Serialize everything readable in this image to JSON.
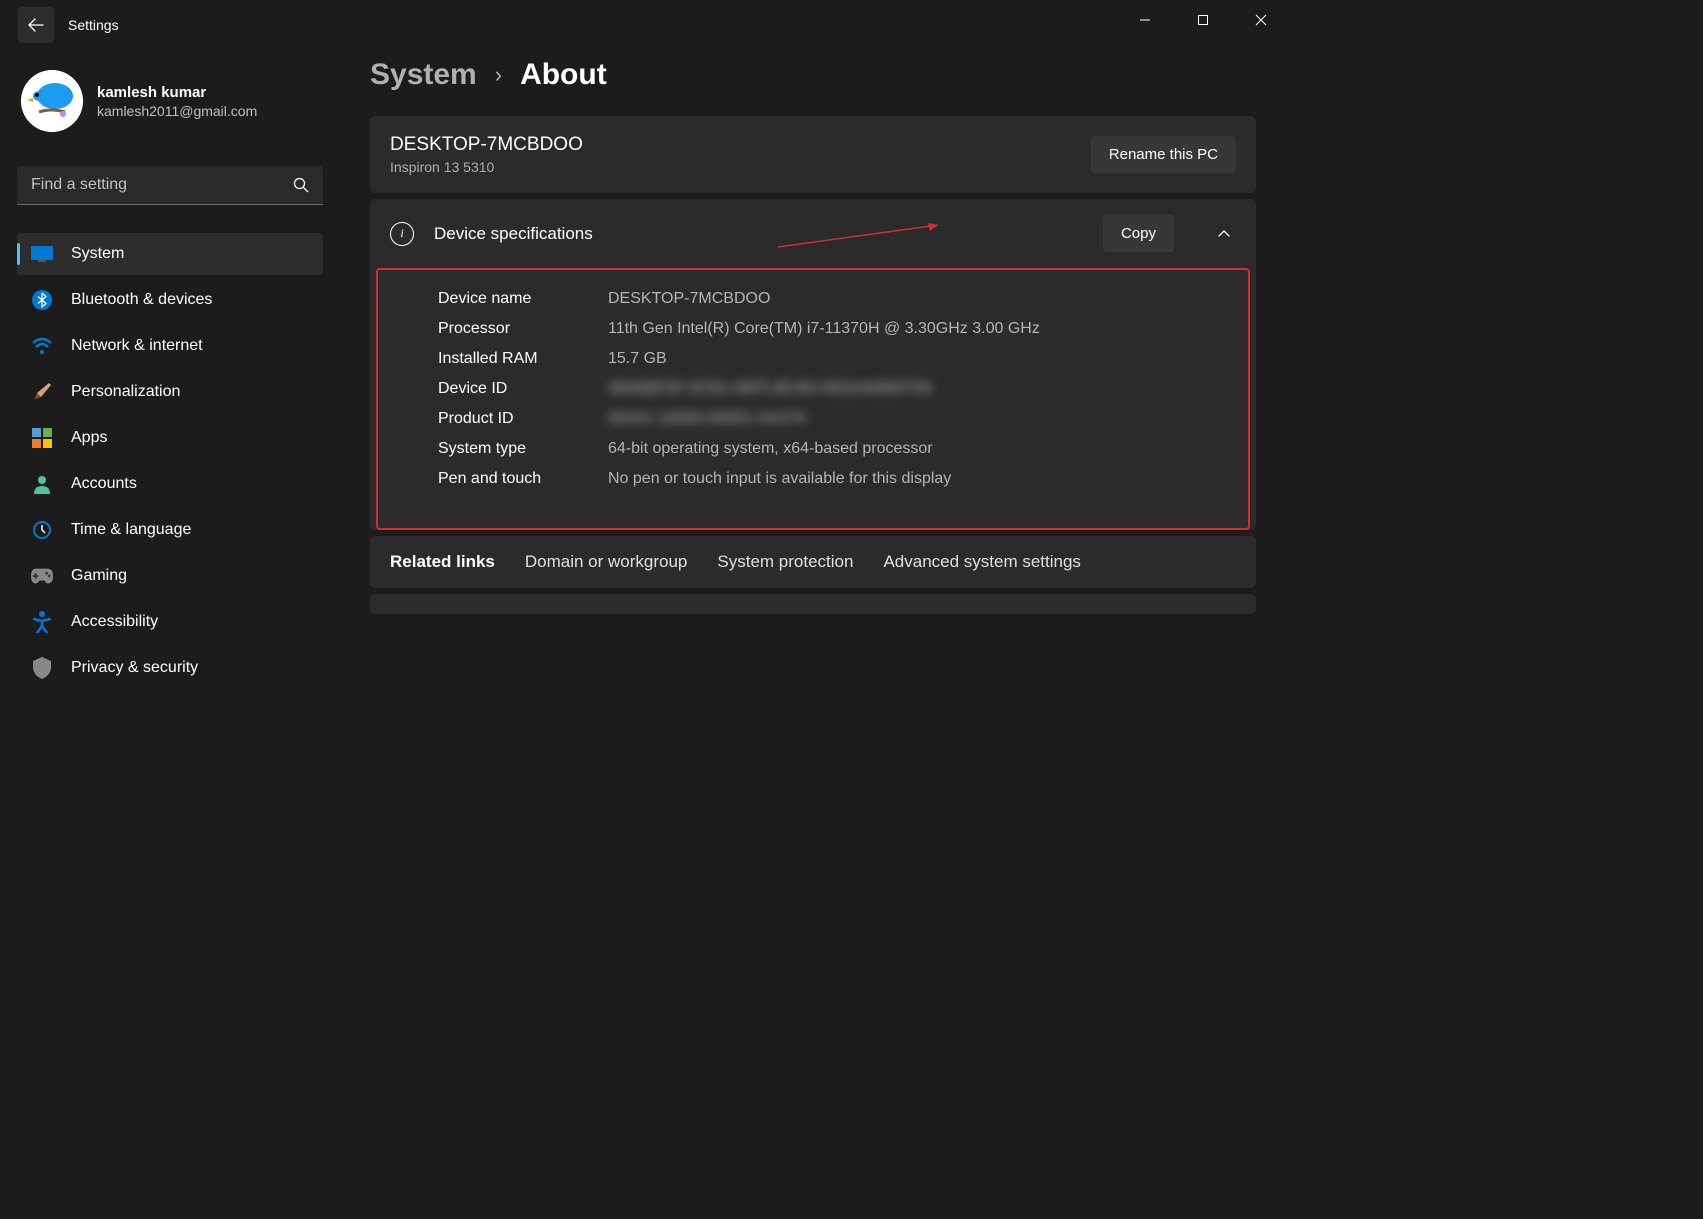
{
  "titlebar": {
    "title": "Settings"
  },
  "profile": {
    "name": "kamlesh kumar",
    "email": "kamlesh2011@gmail.com"
  },
  "search": {
    "placeholder": "Find a setting"
  },
  "nav": [
    {
      "label": "System",
      "icon": "system-icon",
      "active": true
    },
    {
      "label": "Bluetooth & devices",
      "icon": "bluetooth-icon",
      "active": false
    },
    {
      "label": "Network & internet",
      "icon": "wifi-icon",
      "active": false
    },
    {
      "label": "Personalization",
      "icon": "brush-icon",
      "active": false
    },
    {
      "label": "Apps",
      "icon": "apps-icon",
      "active": false
    },
    {
      "label": "Accounts",
      "icon": "accounts-icon",
      "active": false
    },
    {
      "label": "Time & language",
      "icon": "time-icon",
      "active": false
    },
    {
      "label": "Gaming",
      "icon": "gaming-icon",
      "active": false
    },
    {
      "label": "Accessibility",
      "icon": "accessibility-icon",
      "active": false
    },
    {
      "label": "Privacy & security",
      "icon": "privacy-icon",
      "active": false
    }
  ],
  "breadcrumb": {
    "parent": "System",
    "current": "About"
  },
  "pc": {
    "name": "DESKTOP-7MCBDOO",
    "model": "Inspiron 13 5310",
    "rename_label": "Rename this PC"
  },
  "device_specs": {
    "title": "Device specifications",
    "copy_label": "Copy",
    "rows": [
      {
        "label": "Device name",
        "value": "DESKTOP-7MCBDOO",
        "blurred": false
      },
      {
        "label": "Processor",
        "value": "11th Gen Intel(R) Core(TM) i7-11370H @ 3.30GHz   3.00 GHz",
        "blurred": false
      },
      {
        "label": "Installed RAM",
        "value": "15.7 GB",
        "blurred": false
      },
      {
        "label": "Device ID",
        "value": "5B46BF5F-6C82-48F5-BC6D-8932A6800756",
        "blurred": true
      },
      {
        "label": "Product ID",
        "value": "00331-10000-00001-AA376",
        "blurred": true
      },
      {
        "label": "System type",
        "value": "64-bit operating system, x64-based processor",
        "blurred": false
      },
      {
        "label": "Pen and touch",
        "value": "No pen or touch input is available for this display",
        "blurred": false
      }
    ]
  },
  "related": {
    "title": "Related links",
    "links": [
      "Domain or workgroup",
      "System protection",
      "Advanced system settings"
    ]
  }
}
